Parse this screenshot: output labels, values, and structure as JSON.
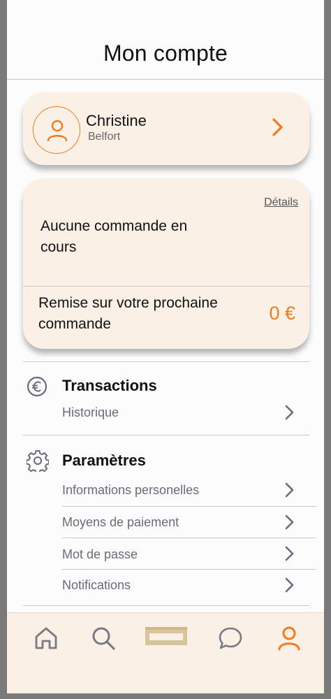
{
  "header": {
    "title": "Mon compte"
  },
  "profile": {
    "name": "Christine",
    "city": "Belfort"
  },
  "order": {
    "details_label": "Détails",
    "status": "Aucune commande en cours",
    "discount_label": "Remise sur votre prochaine commande",
    "discount_value": "0 €"
  },
  "transactions": {
    "title": "Transactions",
    "items": [
      {
        "label": "Historique"
      }
    ]
  },
  "settings": {
    "title": "Paramètres",
    "items": [
      {
        "label": "Informations personelles"
      },
      {
        "label": "Moyens de paiement"
      },
      {
        "label": "Mot de passe"
      },
      {
        "label": "Notifications"
      }
    ]
  },
  "tabbar": {
    "tabs": [
      {
        "icon": "home-icon",
        "active": false
      },
      {
        "icon": "search-icon",
        "active": false
      },
      {
        "icon": "crate-icon",
        "active": false
      },
      {
        "icon": "chat-icon",
        "active": false
      },
      {
        "icon": "user-icon",
        "active": true
      }
    ]
  },
  "colors": {
    "accent": "#f07a1c",
    "card_bg": "#faf0e6",
    "muted": "#6a6a7a"
  }
}
